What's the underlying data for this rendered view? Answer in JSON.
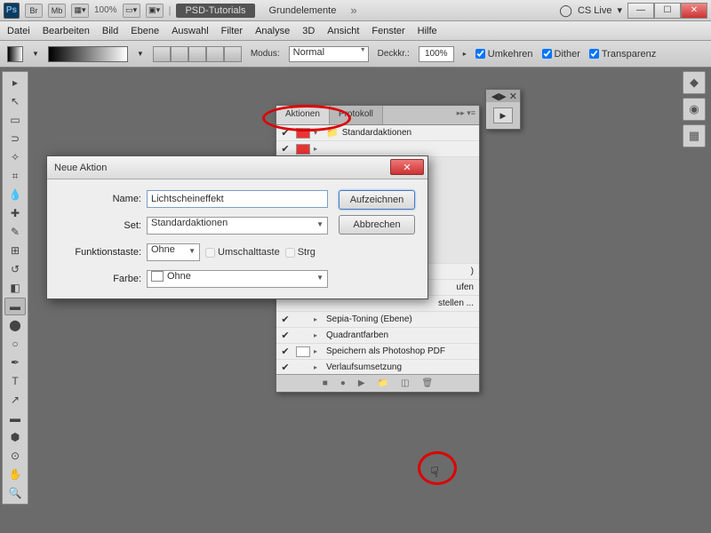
{
  "titlebar": {
    "zoom": "100%",
    "doc1": "PSD-Tutorials",
    "doc2": "Grundelemente",
    "cslive": "CS Live"
  },
  "menu": [
    "Datei",
    "Bearbeiten",
    "Bild",
    "Ebene",
    "Auswahl",
    "Filter",
    "Analyse",
    "3D",
    "Ansicht",
    "Fenster",
    "Hilfe"
  ],
  "optbar": {
    "modus_label": "Modus:",
    "modus_value": "Normal",
    "deckkr_label": "Deckkr.:",
    "deckkr_value": "100%",
    "chk1": "Umkehren",
    "chk2": "Dither",
    "chk3": "Transparenz"
  },
  "actions": {
    "tab1": "Aktionen",
    "tab2": "Protokoll",
    "folder": "Standardaktionen",
    "items": [
      "Sepia-Toning (Ebene)",
      "Quadrantfarben",
      "Speichern als Photoshop PDF",
      "Verlaufsumsetzung"
    ],
    "partial1": ")",
    "partial2": "ufen",
    "partial3": "stellen ..."
  },
  "dialog": {
    "title": "Neue Aktion",
    "name_label": "Name:",
    "name_value": "Lichtscheineffekt",
    "set_label": "Set:",
    "set_value": "Standardaktionen",
    "fkey_label": "Funktionstaste:",
    "fkey_value": "Ohne",
    "shift_label": "Umschalttaste",
    "ctrl_label": "Strg",
    "color_label": "Farbe:",
    "color_value": "Ohne",
    "btn_record": "Aufzeichnen",
    "btn_cancel": "Abbrechen"
  }
}
